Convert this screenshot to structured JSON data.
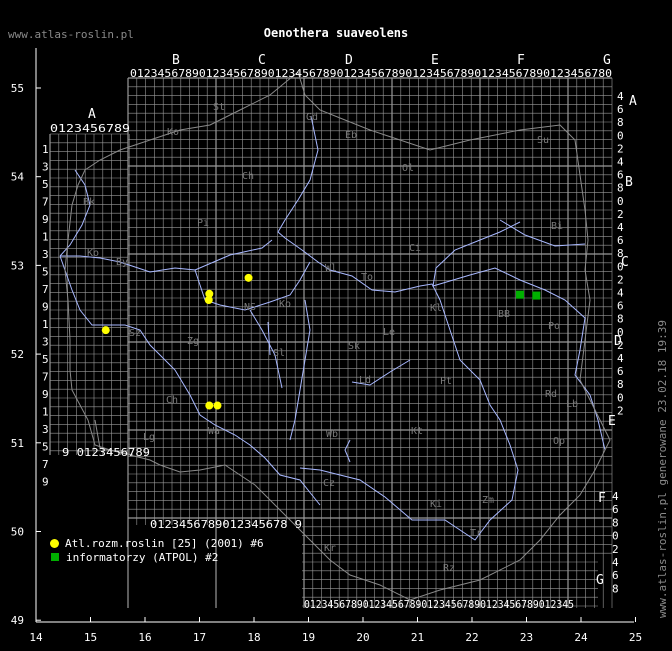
{
  "site_label": "www.atlas-roslin.pl",
  "title": "Oenothera suaveolens",
  "generated_note": "www.atlas-roslin.pl generowane 23.02.18 19:39",
  "axes": {
    "x_ticks": [
      "14",
      "15",
      "16",
      "17",
      "18",
      "19",
      "20",
      "21",
      "22",
      "23",
      "24",
      "25"
    ],
    "y_ticks": [
      "55",
      "54",
      "53",
      "52",
      "51",
      "50",
      "49"
    ]
  },
  "atpol": {
    "col_letters": [
      "B",
      "C",
      "D",
      "E",
      "F",
      "G"
    ],
    "a_letter": "A",
    "right_letters": [
      "A",
      "B",
      "C",
      "D",
      "E"
    ],
    "f_letter": "F",
    "g_letter": "G",
    "top_digits": "0123456789012345678901234567890123456789012345678901234567890123456780",
    "row_a_digits": "0123456789",
    "left_col": [
      "1",
      "3",
      "5",
      "7",
      "9",
      "1",
      "3",
      "5",
      "7",
      "9",
      "1",
      "3",
      "5",
      "7",
      "9",
      "1",
      "3",
      "5",
      "7",
      "9"
    ],
    "bottom_row_a": "9 0123456789",
    "bottom_digits_b": "0123456789012345678 9",
    "bottom_digits_g": "0123456789012345678901234567890123456789012345",
    "right_col_b": [
      "4",
      "6",
      "8",
      "0",
      "2",
      "4",
      "6",
      "8",
      "0",
      "2",
      "4",
      "6",
      "8",
      "0",
      "2",
      "4",
      "6",
      "8",
      "0",
      "2",
      "4",
      "6",
      "8",
      "0",
      "2"
    ],
    "right_col_f": [
      "4",
      "6",
      "8",
      "0",
      "2",
      "4",
      "6",
      "8"
    ]
  },
  "region_labels": [
    "St",
    "Gd",
    "Ko",
    "Eb",
    "Ch",
    "Ol",
    "Su",
    "Pi",
    "Ci",
    "Bi",
    "By",
    "Wl",
    "To",
    "Ko",
    "Bk",
    "Sz",
    "Zg",
    "Le",
    "Sk",
    "Ld",
    "Pt",
    "Rd",
    "Lb",
    "Ch",
    "Lg",
    "Wb",
    "Kt",
    "Op",
    "Cz",
    "Ki",
    "Zm",
    "Tr",
    "Rz",
    "Kr",
    "NS",
    "BB",
    "Kl",
    "Sl",
    "Wa",
    "Ko",
    "Po"
  ],
  "legend": {
    "yellow_label": "Atl.rozm.roslin [25] (2001) #6",
    "green_label": "informatorzy (ATPOL) #2"
  },
  "colors": {
    "grid": "#9a9a9a",
    "rivers": "#a8b8ff",
    "yellow": "#ffff00",
    "green": "#00b000"
  },
  "points": {
    "yellow": [
      [
        17.9,
        52.86
      ],
      [
        17.18,
        52.68
      ],
      [
        17.17,
        52.61
      ],
      [
        15.28,
        52.27
      ],
      [
        17.18,
        51.42
      ],
      [
        17.33,
        51.42
      ]
    ],
    "green": [
      [
        22.88,
        52.67
      ],
      [
        23.18,
        52.66
      ]
    ]
  }
}
